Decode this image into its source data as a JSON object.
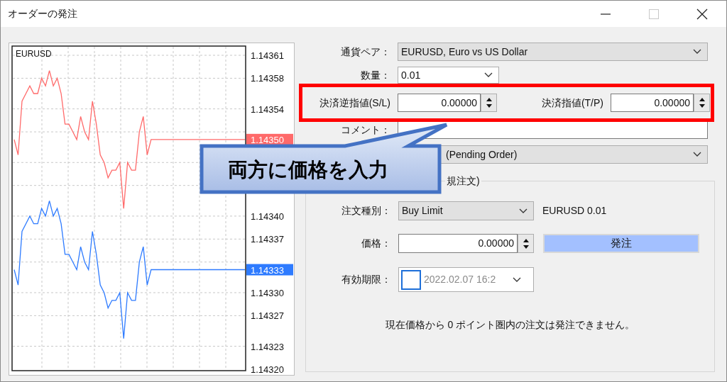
{
  "window": {
    "title": "オーダーの発注",
    "controls": [
      {
        "kind": "minimize",
        "disabled": false
      },
      {
        "kind": "maximize",
        "disabled": true
      },
      {
        "kind": "close",
        "disabled": false
      }
    ]
  },
  "chart": {
    "symbol": "EURUSD",
    "price_tags": [
      {
        "label": "1.14350",
        "color": "#ff6a6a"
      },
      {
        "label": "1.14333",
        "color": "#2e7bff"
      }
    ],
    "chart_data": {
      "type": "line",
      "grid": true,
      "ylim": [
        1.1432,
        1.14361
      ],
      "yticks": [
        {
          "value": 1.14361,
          "label": "1.14361"
        },
        {
          "value": 1.14358,
          "label": "1.14358"
        },
        {
          "value": 1.14354,
          "label": "1.14354"
        },
        {
          "value": 1.1434,
          "label": "1.14340"
        },
        {
          "value": 1.14337,
          "label": "1.14337"
        },
        {
          "value": 1.1433,
          "label": "1.14330"
        },
        {
          "value": 1.14327,
          "label": "1.14327"
        },
        {
          "value": 1.14323,
          "label": "1.14323"
        },
        {
          "value": 1.1432,
          "label": "1.14320"
        }
      ],
      "series": [
        {
          "color": "#ff6a6a",
          "values": [
            1.1435,
            1.14348,
            1.14355,
            1.14356,
            1.14357,
            1.14356,
            1.14356,
            1.14358,
            1.14357,
            1.14359,
            1.14357,
            1.14358,
            1.14356,
            1.14352,
            1.14352,
            1.14351,
            1.1435,
            1.14353,
            1.14351,
            1.1435,
            1.14355,
            1.14352,
            1.14348,
            1.14347,
            1.14345,
            1.14346,
            1.14346,
            1.14347,
            1.14341,
            1.14347,
            1.14346,
            1.14346,
            1.14351,
            1.14353,
            1.14348,
            1.1435,
            1.1435,
            1.1435,
            1.1435,
            1.1435,
            1.1435,
            1.1435,
            1.1435,
            1.1435,
            1.1435,
            1.1435,
            1.1435,
            1.1435,
            1.1435,
            1.1435,
            1.1435,
            1.1435,
            1.1435,
            1.1435,
            1.1435,
            1.1435,
            1.1435,
            1.1435,
            1.1435,
            1.1435
          ]
        },
        {
          "color": "#2e7bff",
          "values": [
            1.14333,
            1.14331,
            1.14338,
            1.14339,
            1.1434,
            1.14339,
            1.14339,
            1.14341,
            1.1434,
            1.14342,
            1.1434,
            1.14341,
            1.14339,
            1.14335,
            1.14335,
            1.14334,
            1.14333,
            1.14336,
            1.14334,
            1.14333,
            1.14338,
            1.14335,
            1.14331,
            1.1433,
            1.14328,
            1.14329,
            1.14329,
            1.1433,
            1.14324,
            1.1433,
            1.14329,
            1.14329,
            1.14334,
            1.14336,
            1.14331,
            1.14333,
            1.14333,
            1.14333,
            1.14333,
            1.14333,
            1.14333,
            1.14333,
            1.14333,
            1.14333,
            1.14333,
            1.14333,
            1.14333,
            1.14333,
            1.14333,
            1.14333,
            1.14333,
            1.14333,
            1.14333,
            1.14333,
            1.14333,
            1.14333,
            1.14333,
            1.14333,
            1.14333,
            1.14333
          ]
        }
      ]
    }
  },
  "form": {
    "symbol": {
      "label": "通貨ペア：",
      "value": "EURUSD, Euro vs US Dollar"
    },
    "volume": {
      "label": "数量：",
      "value": "0.01"
    },
    "stop_loss": {
      "label": "決済逆指値(S/L)",
      "value": "0.00000"
    },
    "take_profit": {
      "label": "決済指値(T/P)",
      "value": "0.00000"
    },
    "comment": {
      "label": "コメント："
    },
    "order_type": {
      "value": "(Pending Order)"
    },
    "group": {
      "legend": "規注文)",
      "type": {
        "label": "注文種別：",
        "value": "Buy Limit",
        "info": "EURUSD 0.01"
      },
      "price": {
        "label": "価格：",
        "value": "0.00000"
      },
      "button": "発注",
      "expiry": {
        "label": "有効期限：",
        "checked": false,
        "value": "2022.02.07 16:2"
      },
      "note": "現在価格から 0 ポイント圏内の注文は発注できません。"
    }
  },
  "callout": {
    "text": "**両方**に価格を入力"
  }
}
